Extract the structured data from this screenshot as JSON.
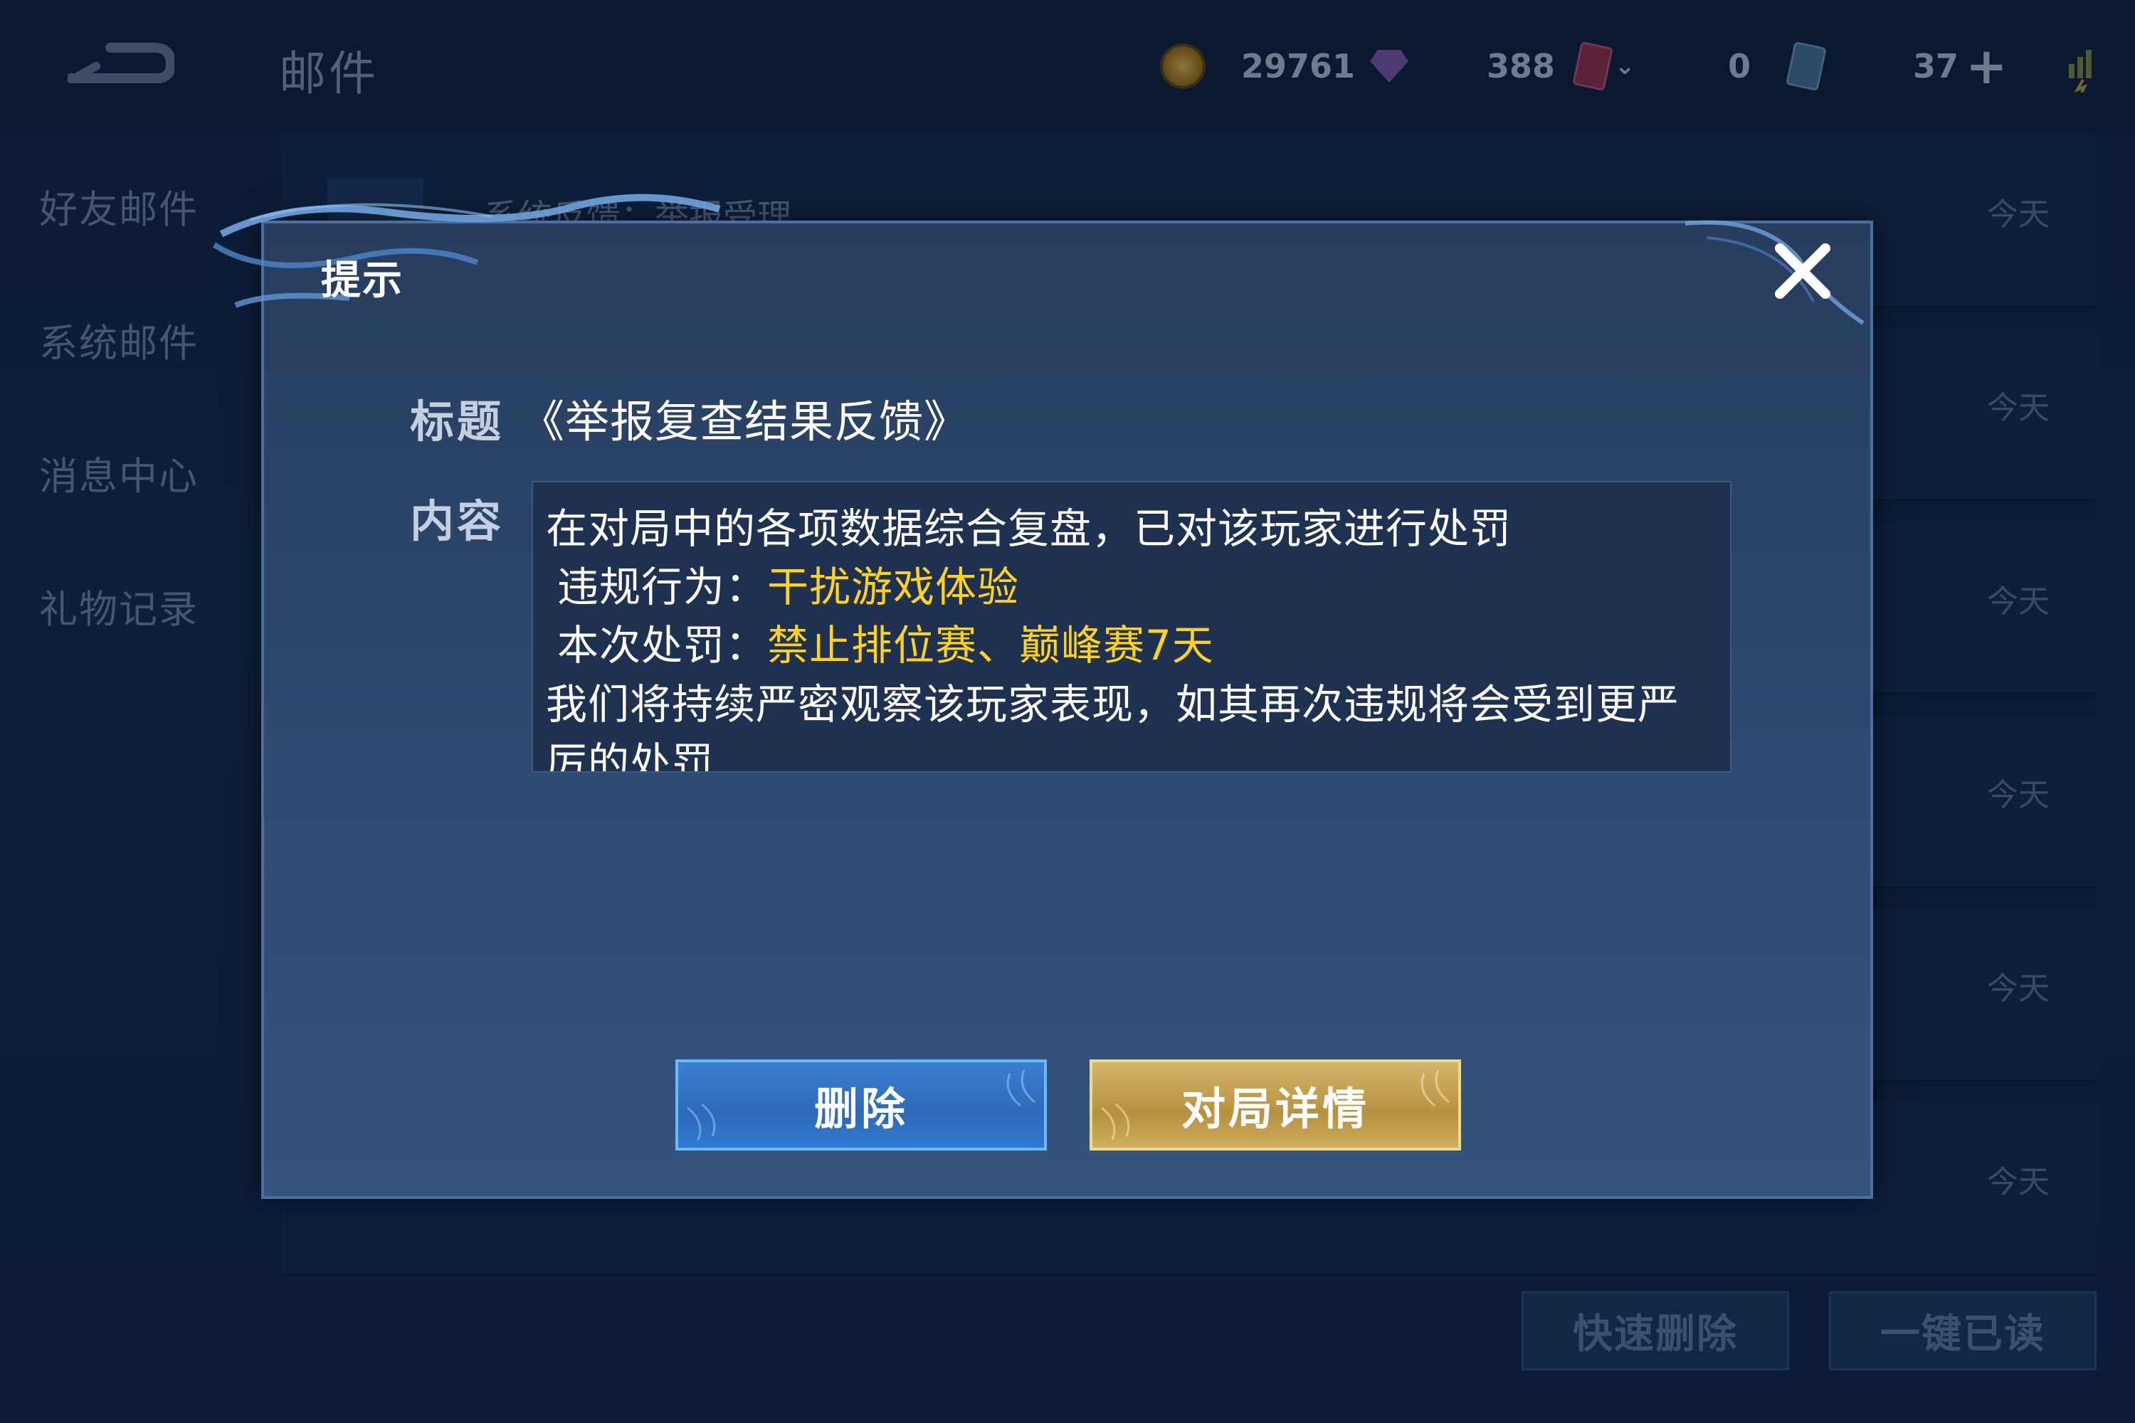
{
  "header": {
    "page_title": "邮件",
    "currencies": [
      {
        "icon": "gold-coin-icon",
        "value": "29761"
      },
      {
        "icon": "gem-icon",
        "value": "388"
      },
      {
        "icon": "card-icon",
        "value": ""
      },
      {
        "icon": "ticket-icon",
        "value": "0"
      },
      {
        "icon": "plus-icon",
        "value": "37"
      }
    ]
  },
  "sidebar": {
    "items": [
      {
        "label": "好友邮件"
      },
      {
        "label": "系统邮件"
      },
      {
        "label": "消息中心"
      },
      {
        "label": "礼物记录"
      }
    ]
  },
  "mail_list": {
    "rows": [
      {
        "title": "系统反馈：举报受理",
        "date": "今天"
      },
      {
        "title": "",
        "date": "今天"
      },
      {
        "title": "",
        "date": "今天"
      },
      {
        "title": "",
        "date": "今天"
      },
      {
        "title": "",
        "date": "今天"
      },
      {
        "title": "",
        "date": "今天"
      }
    ],
    "quick_delete_label": "快速删除",
    "mark_all_read_label": "一键已读"
  },
  "dialog": {
    "heading": "提示",
    "title_label": "标题",
    "title_value": "《举报复查结果反馈》",
    "content_label": "内容",
    "content": {
      "line1": "在对局中的各项数据综合复盘，已对该玩家进行处罚",
      "violation_prefix": "违规行为：",
      "violation_value": "干扰游戏体验",
      "penalty_prefix": "本次处罚：",
      "penalty_value": "禁止排位赛、巅峰赛7天",
      "line4": "我们将持续严密观察该玩家表现，如其再次违规将会受到更严",
      "line5": "厉的处罚"
    },
    "delete_label": "删除",
    "match_detail_label": "对局详情",
    "colors": {
      "highlight": "#ffd21c",
      "delete_button": "#2d69b8",
      "detail_button": "#b7913f"
    }
  }
}
